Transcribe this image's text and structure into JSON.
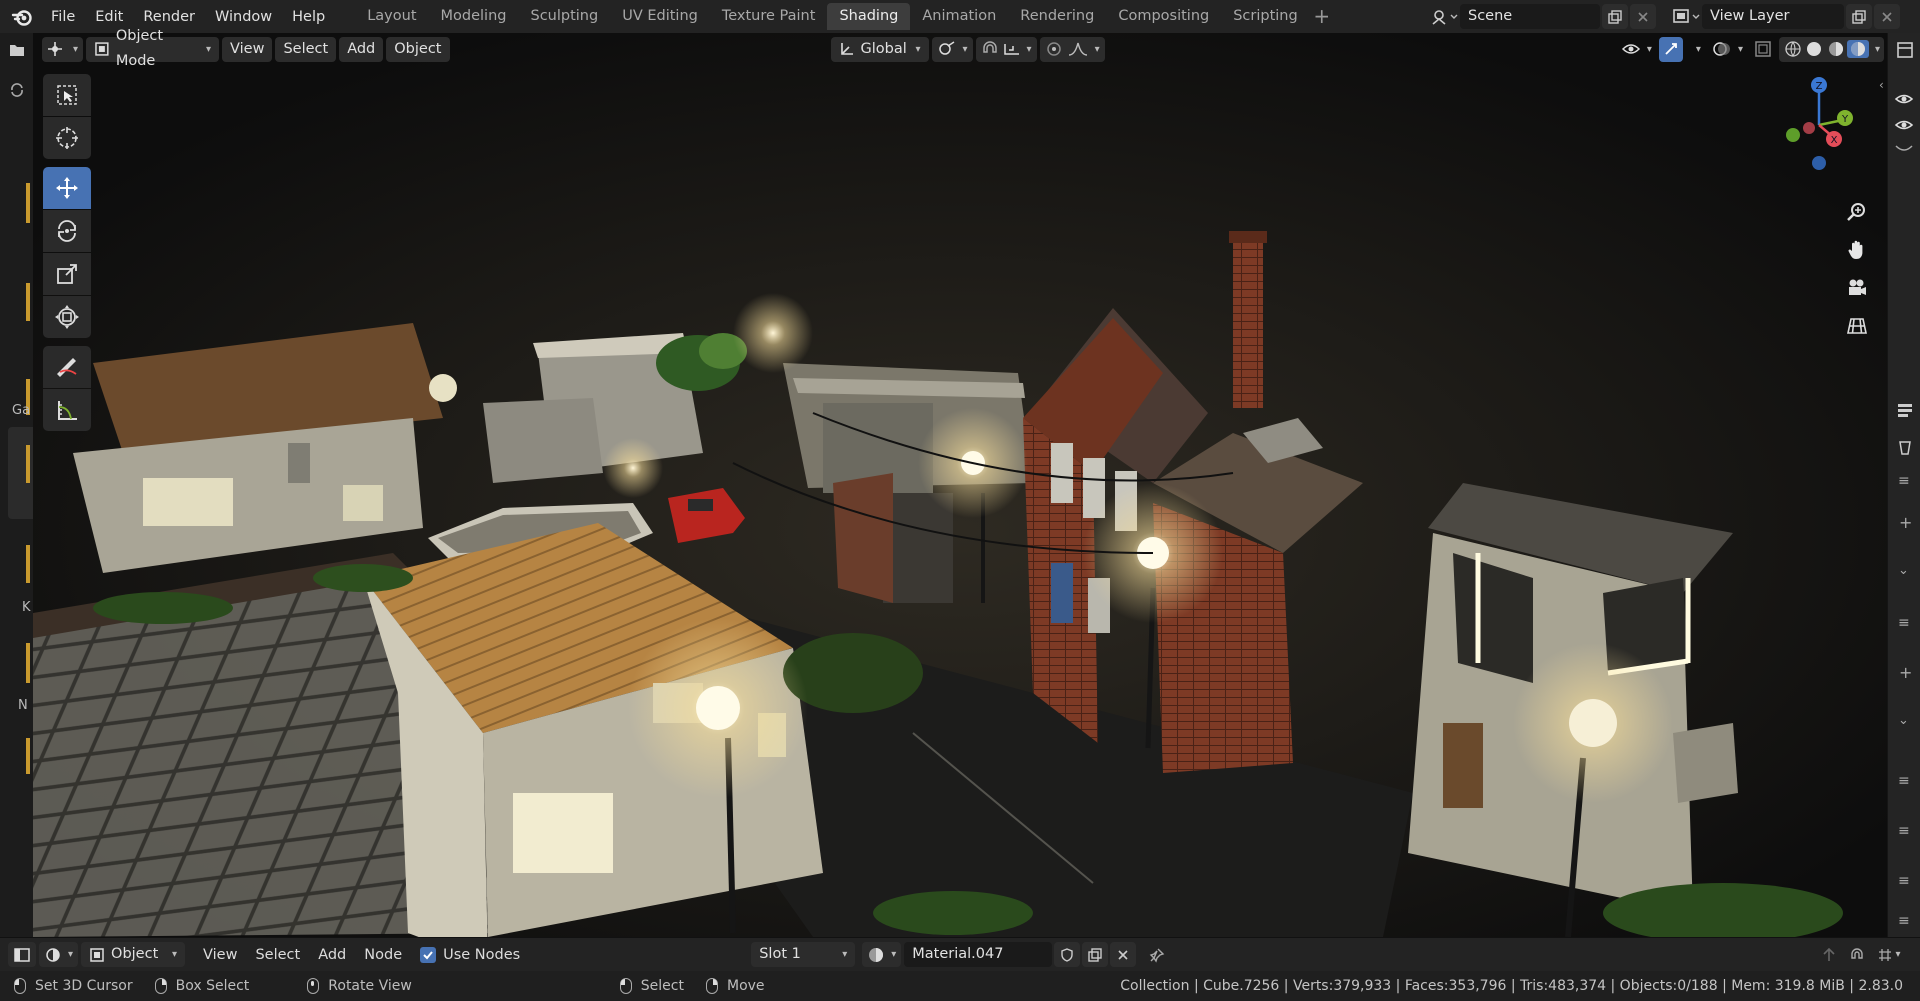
{
  "topbar": {
    "menus": [
      "File",
      "Edit",
      "Render",
      "Window",
      "Help"
    ],
    "workspaces": [
      "Layout",
      "Modeling",
      "Sculpting",
      "UV Editing",
      "Texture Paint",
      "Shading",
      "Animation",
      "Rendering",
      "Compositing",
      "Scripting"
    ],
    "active_workspace": "Shading",
    "scene_name": "Scene",
    "view_layer": "View Layer"
  },
  "viewport_header": {
    "mode": "Object Mode",
    "menus": [
      "View",
      "Select",
      "Add",
      "Object"
    ],
    "transform_orientation": "Global"
  },
  "toolbar": {
    "tools": [
      "select-box",
      "cursor",
      "move",
      "rotate",
      "scale",
      "transform",
      "annotate",
      "measure"
    ],
    "active_tool": "move"
  },
  "nav_gizmo": {
    "axes": [
      "Z",
      "Y",
      "X"
    ],
    "colors": {
      "x": "#e44d59",
      "y": "#7fb32e",
      "z": "#3a78d4"
    }
  },
  "left_strip_labels": [
    "Ga",
    "K",
    "N"
  ],
  "node_editor_header": {
    "object_type": "Object",
    "menus": [
      "View",
      "Select",
      "Add",
      "Node"
    ],
    "use_nodes_label": "Use Nodes",
    "slot": "Slot 1",
    "material": "Material.047"
  },
  "statusbar": {
    "set_cursor": "Set 3D Cursor",
    "box_select": "Box Select",
    "rotate_view": "Rotate View",
    "select": "Select",
    "move": "Move",
    "stats": "Collection | Cube.7256 | Verts:379,933 | Faces:353,796 | Tris:483,374 | Objects:0/188 | Mem: 319.8 MiB | 2.83.0"
  },
  "colors": {
    "accent": "#4772b3",
    "header_bg": "#232323",
    "viewport_bg": "#0d0d0d"
  }
}
